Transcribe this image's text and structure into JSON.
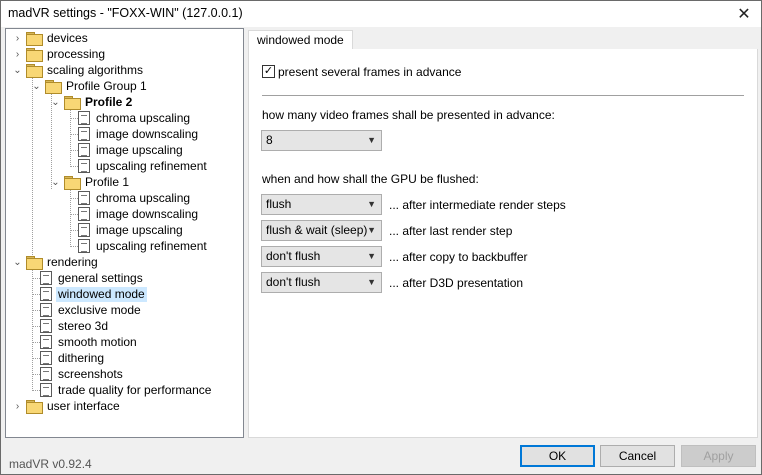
{
  "window": {
    "title": "madVR settings - \"FOXX-WIN\" (127.0.0.1)",
    "version": "madVR v0.92.4"
  },
  "tree": {
    "devices": "devices",
    "processing": "processing",
    "scaling": "scaling algorithms",
    "profile_group_1": "Profile Group 1",
    "profile_2": "Profile 2",
    "p2_chroma": "chroma upscaling",
    "p2_downscaling": "image downscaling",
    "p2_upscaling": "image upscaling",
    "p2_refinement": "upscaling refinement",
    "profile_1": "Profile 1",
    "p1_chroma": "chroma upscaling",
    "p1_downscaling": "image downscaling",
    "p1_upscaling": "image upscaling",
    "p1_refinement": "upscaling refinement",
    "rendering": "rendering",
    "general": "general settings",
    "windowed": "windowed mode",
    "exclusive": "exclusive mode",
    "stereo": "stereo 3d",
    "smooth": "smooth motion",
    "dithering": "dithering",
    "screenshots": "screenshots",
    "trade": "trade quality for performance",
    "ui": "user interface"
  },
  "tab": {
    "label": "windowed mode"
  },
  "settings": {
    "present_frames": {
      "label": "present several frames in advance",
      "checked": true
    },
    "frames_question": "how many video frames shall be presented in advance:",
    "frames_value": "8",
    "flush_question": "when and how shall the GPU be flushed:",
    "flush_rows": [
      {
        "value": "flush",
        "label": "... after intermediate render steps"
      },
      {
        "value": "flush & wait (sleep)",
        "label": "... after last render step"
      },
      {
        "value": "don't flush",
        "label": "... after copy to backbuffer"
      },
      {
        "value": "don't flush",
        "label": "... after D3D presentation"
      }
    ]
  },
  "buttons": {
    "ok": "OK",
    "cancel": "Cancel",
    "apply": "Apply"
  }
}
